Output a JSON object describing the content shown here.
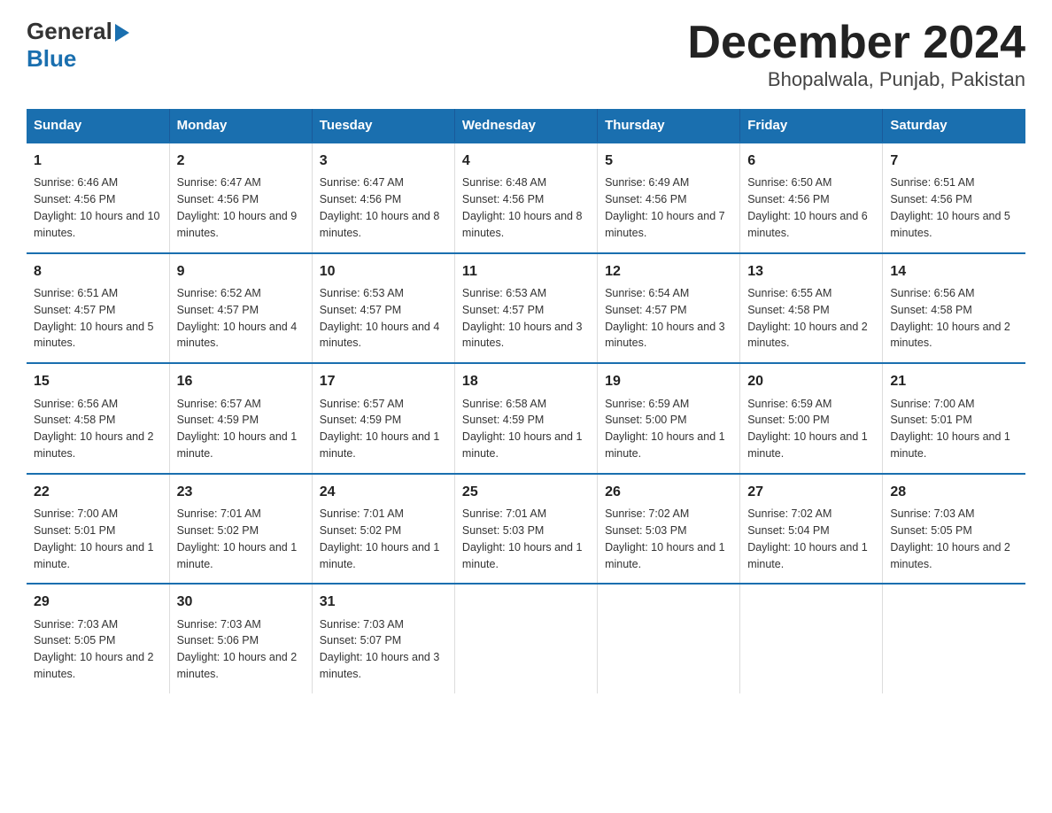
{
  "header": {
    "logo_general": "General",
    "logo_blue": "Blue",
    "title": "December 2024",
    "subtitle": "Bhopalwala, Punjab, Pakistan"
  },
  "days_of_week": [
    "Sunday",
    "Monday",
    "Tuesday",
    "Wednesday",
    "Thursday",
    "Friday",
    "Saturday"
  ],
  "weeks": [
    [
      {
        "day": "1",
        "sunrise": "6:46 AM",
        "sunset": "4:56 PM",
        "daylight": "10 hours and 10 minutes."
      },
      {
        "day": "2",
        "sunrise": "6:47 AM",
        "sunset": "4:56 PM",
        "daylight": "10 hours and 9 minutes."
      },
      {
        "day": "3",
        "sunrise": "6:47 AM",
        "sunset": "4:56 PM",
        "daylight": "10 hours and 8 minutes."
      },
      {
        "day": "4",
        "sunrise": "6:48 AM",
        "sunset": "4:56 PM",
        "daylight": "10 hours and 8 minutes."
      },
      {
        "day": "5",
        "sunrise": "6:49 AM",
        "sunset": "4:56 PM",
        "daylight": "10 hours and 7 minutes."
      },
      {
        "day": "6",
        "sunrise": "6:50 AM",
        "sunset": "4:56 PM",
        "daylight": "10 hours and 6 minutes."
      },
      {
        "day": "7",
        "sunrise": "6:51 AM",
        "sunset": "4:56 PM",
        "daylight": "10 hours and 5 minutes."
      }
    ],
    [
      {
        "day": "8",
        "sunrise": "6:51 AM",
        "sunset": "4:57 PM",
        "daylight": "10 hours and 5 minutes."
      },
      {
        "day": "9",
        "sunrise": "6:52 AM",
        "sunset": "4:57 PM",
        "daylight": "10 hours and 4 minutes."
      },
      {
        "day": "10",
        "sunrise": "6:53 AM",
        "sunset": "4:57 PM",
        "daylight": "10 hours and 4 minutes."
      },
      {
        "day": "11",
        "sunrise": "6:53 AM",
        "sunset": "4:57 PM",
        "daylight": "10 hours and 3 minutes."
      },
      {
        "day": "12",
        "sunrise": "6:54 AM",
        "sunset": "4:57 PM",
        "daylight": "10 hours and 3 minutes."
      },
      {
        "day": "13",
        "sunrise": "6:55 AM",
        "sunset": "4:58 PM",
        "daylight": "10 hours and 2 minutes."
      },
      {
        "day": "14",
        "sunrise": "6:56 AM",
        "sunset": "4:58 PM",
        "daylight": "10 hours and 2 minutes."
      }
    ],
    [
      {
        "day": "15",
        "sunrise": "6:56 AM",
        "sunset": "4:58 PM",
        "daylight": "10 hours and 2 minutes."
      },
      {
        "day": "16",
        "sunrise": "6:57 AM",
        "sunset": "4:59 PM",
        "daylight": "10 hours and 1 minute."
      },
      {
        "day": "17",
        "sunrise": "6:57 AM",
        "sunset": "4:59 PM",
        "daylight": "10 hours and 1 minute."
      },
      {
        "day": "18",
        "sunrise": "6:58 AM",
        "sunset": "4:59 PM",
        "daylight": "10 hours and 1 minute."
      },
      {
        "day": "19",
        "sunrise": "6:59 AM",
        "sunset": "5:00 PM",
        "daylight": "10 hours and 1 minute."
      },
      {
        "day": "20",
        "sunrise": "6:59 AM",
        "sunset": "5:00 PM",
        "daylight": "10 hours and 1 minute."
      },
      {
        "day": "21",
        "sunrise": "7:00 AM",
        "sunset": "5:01 PM",
        "daylight": "10 hours and 1 minute."
      }
    ],
    [
      {
        "day": "22",
        "sunrise": "7:00 AM",
        "sunset": "5:01 PM",
        "daylight": "10 hours and 1 minute."
      },
      {
        "day": "23",
        "sunrise": "7:01 AM",
        "sunset": "5:02 PM",
        "daylight": "10 hours and 1 minute."
      },
      {
        "day": "24",
        "sunrise": "7:01 AM",
        "sunset": "5:02 PM",
        "daylight": "10 hours and 1 minute."
      },
      {
        "day": "25",
        "sunrise": "7:01 AM",
        "sunset": "5:03 PM",
        "daylight": "10 hours and 1 minute."
      },
      {
        "day": "26",
        "sunrise": "7:02 AM",
        "sunset": "5:03 PM",
        "daylight": "10 hours and 1 minute."
      },
      {
        "day": "27",
        "sunrise": "7:02 AM",
        "sunset": "5:04 PM",
        "daylight": "10 hours and 1 minute."
      },
      {
        "day": "28",
        "sunrise": "7:03 AM",
        "sunset": "5:05 PM",
        "daylight": "10 hours and 2 minutes."
      }
    ],
    [
      {
        "day": "29",
        "sunrise": "7:03 AM",
        "sunset": "5:05 PM",
        "daylight": "10 hours and 2 minutes."
      },
      {
        "day": "30",
        "sunrise": "7:03 AM",
        "sunset": "5:06 PM",
        "daylight": "10 hours and 2 minutes."
      },
      {
        "day": "31",
        "sunrise": "7:03 AM",
        "sunset": "5:07 PM",
        "daylight": "10 hours and 3 minutes."
      },
      null,
      null,
      null,
      null
    ]
  ]
}
